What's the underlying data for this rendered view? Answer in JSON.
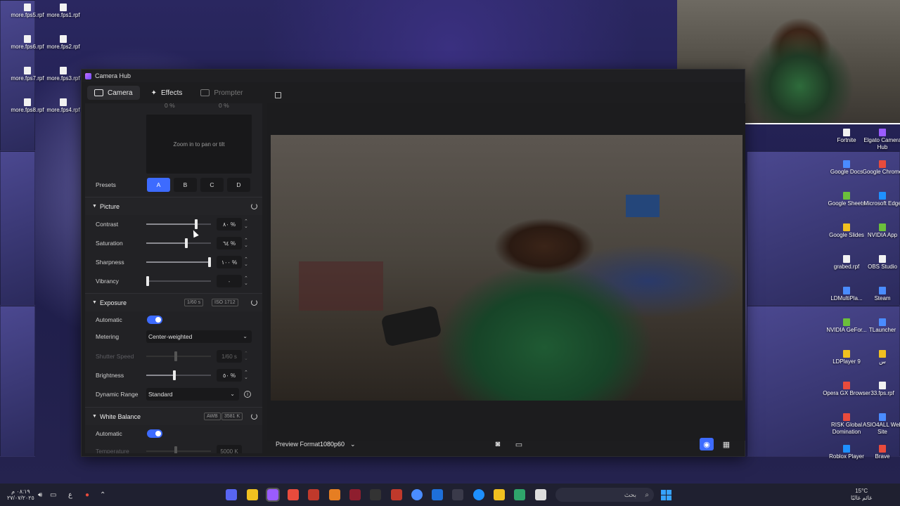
{
  "desktop": {
    "left_files": [
      "more.fps5.rpf",
      "more.fps1.rpf",
      "more.fps6.rpf",
      "more.fps2.rpf",
      "more.fps7.rpf",
      "more.fps3.rpf",
      "more.fps8.rpf",
      "more.fps4.rpf"
    ],
    "right_icons": [
      {
        "label": "Fortnite",
        "icon": "fortnite-icon",
        "color": "#f2f2f2"
      },
      {
        "label": "Elgato Camera Hub",
        "icon": "elgato-icon",
        "color": "#9a5cff"
      },
      {
        "label": "Google Docs",
        "icon": "google-docs-icon",
        "color": "#4a8cff"
      },
      {
        "label": "Google Chrome",
        "icon": "chrome-icon",
        "color": "#e94b3c"
      },
      {
        "label": "Google Sheets",
        "icon": "google-sheets-icon",
        "color": "#6bbf3b"
      },
      {
        "label": "Microsoft Edge",
        "icon": "edge-icon",
        "color": "#1e90ff"
      },
      {
        "label": "Google Slides",
        "icon": "google-slides-icon",
        "color": "#f0c020"
      },
      {
        "label": "NVIDIA App",
        "icon": "nvidia-icon",
        "color": "#6bbf3b"
      },
      {
        "label": "grabed.rpf",
        "icon": "file-icon",
        "color": "#f2f2f2"
      },
      {
        "label": "OBS Studio",
        "icon": "obs-icon",
        "color": "#f2f2f2"
      },
      {
        "label": "LDMultiPla...",
        "icon": "ldmultiplayer-icon",
        "color": "#4a8cff"
      },
      {
        "label": "Steam",
        "icon": "steam-icon",
        "color": "#4a8cff"
      },
      {
        "label": "NVIDIA GeFor...",
        "icon": "nvidia-geforce-icon",
        "color": "#6bbf3b"
      },
      {
        "label": "TLauncher",
        "icon": "tlauncher-icon",
        "color": "#4a8cff"
      },
      {
        "label": "LDPlayer 9",
        "icon": "ldplayer-icon",
        "color": "#f0c020"
      },
      {
        "label": "س",
        "icon": "folder-icon",
        "color": "#f0c020"
      },
      {
        "label": "Opera GX Browser",
        "icon": "opera-gx-icon",
        "color": "#e94b3c"
      },
      {
        "label": "33.fps.rpf",
        "icon": "file-icon",
        "color": "#f2f2f2"
      },
      {
        "label": "RISK Global Domination",
        "icon": "risk-icon",
        "color": "#e94b3c"
      },
      {
        "label": "ASIO4ALL Web Site",
        "icon": "asio-icon",
        "color": "#4a8cff"
      },
      {
        "label": "Roblox Player",
        "icon": "roblox-icon",
        "color": "#1e90ff"
      },
      {
        "label": "Brave",
        "icon": "brave-icon",
        "color": "#e94b3c"
      }
    ]
  },
  "window": {
    "title": "Camera Hub",
    "tabs": [
      {
        "label": "Camera",
        "state": "active"
      },
      {
        "label": "Effects",
        "state": "normal"
      },
      {
        "label": "Prompter",
        "state": "disabled"
      }
    ]
  },
  "panel": {
    "top_partial": {
      "left_val": "0 %",
      "right_val": "0 %"
    },
    "pad_hint": "Zoom in to pan or tilt",
    "presets": {
      "label": "Presets",
      "items": [
        "A",
        "B",
        "C",
        "D"
      ],
      "active": "A"
    },
    "picture": {
      "title": "Picture",
      "rows": [
        {
          "label": "Contrast",
          "value": "٨٠ %",
          "level": 0.78
        },
        {
          "label": "Saturation",
          "value": "٦٤ %",
          "level": 0.63
        },
        {
          "label": "Sharpness",
          "value": "١٠٠ %",
          "level": 1.0
        },
        {
          "label": "Vibrancy",
          "value": "٠",
          "level": 0.0
        }
      ]
    },
    "exposure": {
      "title": "Exposure",
      "badge_shutter": "1/60 s",
      "badge_iso_label": "ISO",
      "badge_iso_value": "1712",
      "automatic_label": "Automatic",
      "automatic_on": true,
      "metering_label": "Metering",
      "metering_value": "Center-weighted",
      "shutter_label": "Shutter Speed",
      "shutter_value": "1/60 s",
      "brightness_label": "Brightness",
      "brightness_value": "٥٠ %",
      "dynamic_label": "Dynamic Range",
      "dynamic_value": "Standard"
    },
    "white_balance": {
      "title": "White Balance",
      "badge_awb": "AWB",
      "badge_k": "3581 K",
      "automatic_label": "Automatic",
      "automatic_on": true,
      "temperature_label": "Temperature",
      "temperature_value": "5000 K"
    }
  },
  "preview": {
    "format_label": "Preview Format",
    "format_value": "1080p60"
  },
  "taskbar": {
    "time": "٠٨:١٩ م",
    "date": "٢٧/٠٧/٢٠٢٥",
    "lang": "ع",
    "search_placeholder": "بحث",
    "weather_temp": "15°C",
    "weather_desc": "غائم غالبًا",
    "accent": "#36a2ff"
  }
}
